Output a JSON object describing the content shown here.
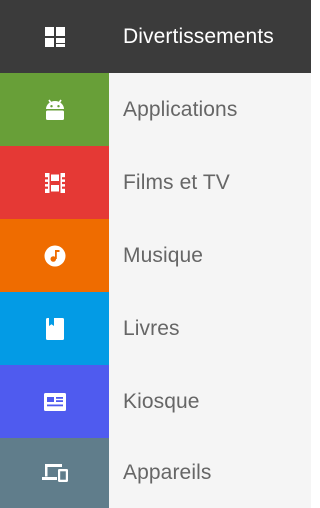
{
  "menu": {
    "items": [
      {
        "label": "Divertissements",
        "icon": "apps-grid-icon",
        "color": "#3b3b3b",
        "active": true
      },
      {
        "label": "Applications",
        "icon": "android-icon",
        "color": "#689f38"
      },
      {
        "label": "Films et TV",
        "icon": "film-icon",
        "color": "#e53935"
      },
      {
        "label": "Musique",
        "icon": "music-note-icon",
        "color": "#ef6c00"
      },
      {
        "label": "Livres",
        "icon": "book-icon",
        "color": "#039be5"
      },
      {
        "label": "Kiosque",
        "icon": "newspaper-icon",
        "color": "#4f5bef"
      },
      {
        "label": "Appareils",
        "icon": "devices-icon",
        "color": "#607d8b"
      }
    ]
  }
}
